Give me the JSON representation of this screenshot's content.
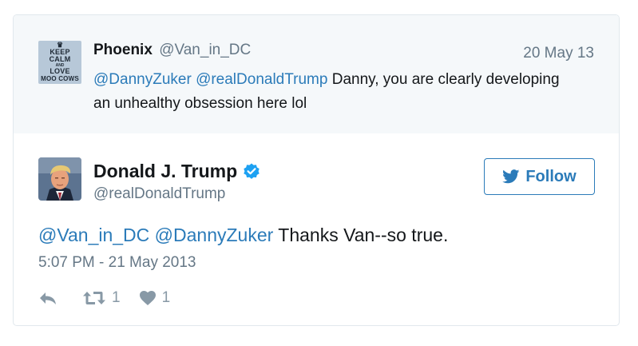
{
  "parent_tweet": {
    "avatar_lines": [
      "KEEP",
      "CALM",
      "AND",
      "LOVE",
      "MOO COWS"
    ],
    "name": "Phoenix",
    "handle": "@Van_in_DC",
    "date": "20 May 13",
    "mentions": [
      "@DannyZuker",
      "@realDonaldTrump"
    ],
    "text": "Danny, you are clearly developing an unhealthy obsession here lol"
  },
  "tweet": {
    "name": "Donald J. Trump",
    "handle": "@realDonaldTrump",
    "follow_label": "Follow",
    "mentions": [
      "@Van_in_DC",
      "@DannyZuker"
    ],
    "text": "Thanks Van--so true.",
    "timestamp": "5:07 PM - 21 May 2013",
    "retweet_count": "1",
    "like_count": "1"
  },
  "colors": {
    "link": "#2b7bb9",
    "muted": "#657786",
    "icon": "#8899a6",
    "verified": "#1da1f2",
    "parent_bg": "#f5f8fa"
  },
  "icons": {
    "verified": "verified-badge-icon",
    "follow": "twitter-bird-icon",
    "reply": "reply-icon",
    "retweet": "retweet-icon",
    "like": "heart-icon"
  }
}
